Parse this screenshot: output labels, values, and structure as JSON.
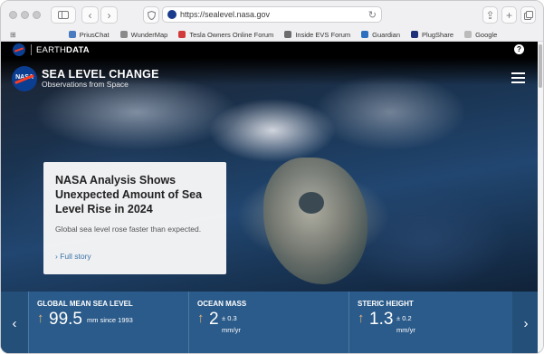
{
  "browser": {
    "url": "https://sealevel.nasa.gov",
    "bookmarks": [
      {
        "label": "PriusChat",
        "color": "#4a7ac0"
      },
      {
        "label": "WunderMap",
        "color": "#8a8a8a"
      },
      {
        "label": "Tesla Owners Online Forum",
        "color": "#d23b3b"
      },
      {
        "label": "Inside EVS Forum",
        "color": "#6d6d6d"
      },
      {
        "label": "Guardian",
        "color": "#2d6fbf"
      },
      {
        "label": "PlugShare",
        "color": "#1f2f7a"
      },
      {
        "label": "Google",
        "color": "#bbbbbb"
      }
    ]
  },
  "earthdata": {
    "prefix": "EARTH",
    "suffix": "DATA",
    "help": "?"
  },
  "site": {
    "logo_text": "NASA",
    "title": "SEA LEVEL CHANGE",
    "subtitle": "Observations from Space"
  },
  "card": {
    "title": "NASA Analysis Shows Unexpected Amount of Sea Level Rise in 2024",
    "text": "Global sea level rose faster than expected.",
    "link": "› Full story"
  },
  "stats": [
    {
      "label": "GLOBAL MEAN SEA LEVEL",
      "value": "99.5",
      "unit": "mm since 1993",
      "pm": ""
    },
    {
      "label": "OCEAN MASS",
      "value": "2",
      "unit": "mm/yr",
      "pm": "± 0.3"
    },
    {
      "label": "STERIC HEIGHT",
      "value": "1.3",
      "unit": "mm/yr",
      "pm": "± 0.2"
    }
  ],
  "nav": {
    "prev": "‹",
    "next": "›"
  }
}
